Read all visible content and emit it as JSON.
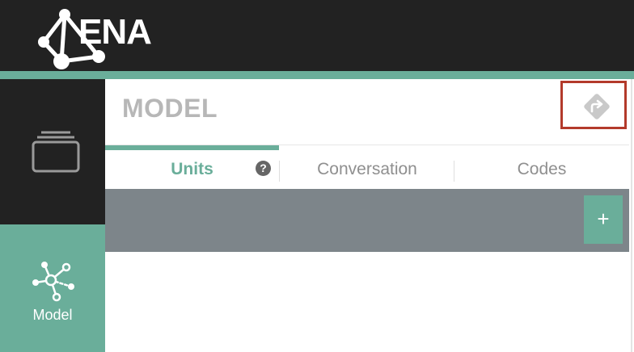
{
  "header": {
    "brand_text": "ENA",
    "logo_icon": "network-graph-logo"
  },
  "sidebar": {
    "items": [
      {
        "icon": "layers-icon",
        "label": ""
      },
      {
        "icon": "network-model-icon",
        "label": "Model",
        "active": true
      }
    ]
  },
  "main": {
    "title": "MODEL",
    "share_icon": "share-arrow-icon",
    "tabs": [
      {
        "label": "Units",
        "active": true,
        "has_help": true,
        "help_glyph": "?"
      },
      {
        "label": "Conversation"
      },
      {
        "label": "Codes"
      }
    ],
    "add_button_label": "+"
  },
  "colors": {
    "accent": "#6aae9a",
    "topbar": "#222222",
    "toolbar": "#7d858a",
    "highlight_border": "#b33a2b"
  }
}
